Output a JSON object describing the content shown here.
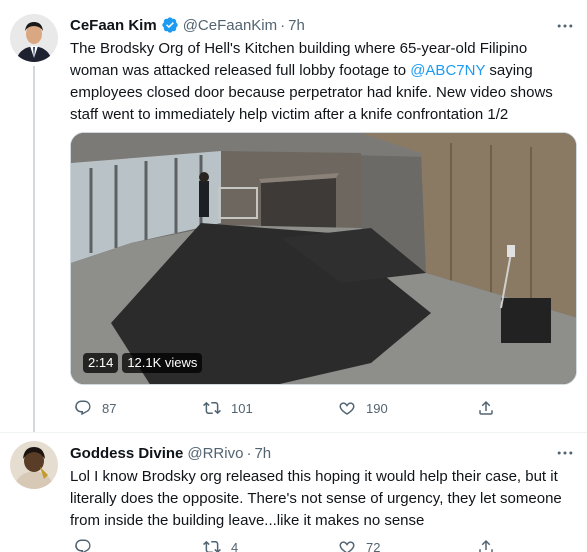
{
  "tweets": [
    {
      "author": {
        "name": "CeFaan Kim",
        "handle": "@CeFaanKim",
        "time": "7h",
        "verified": true
      },
      "text_before_mention": "The Brodsky Org of Hell's Kitchen building where 65-year-old Filipino woman was attacked released full lobby footage to ",
      "mention": "@ABC7NY",
      "text_after_mention": " saying employees closed door because perpetrator had knife. New video shows staff went to immediately help victim after a knife confrontation 1/2",
      "media": {
        "duration": "2:14",
        "views": "12.1K views"
      },
      "actions": {
        "replies": "87",
        "retweets": "101",
        "likes": "190"
      }
    },
    {
      "author": {
        "name": "Goddess Divine",
        "handle": "@RRivo",
        "time": "7h"
      },
      "text": "Lol I know Brodsky org released this hoping it would help their case, but it literally does the opposite. There's not sense of urgency, they let someone from inside the building leave...like it makes no sense",
      "actions": {
        "replies": "",
        "retweets": "4",
        "likes": "72"
      }
    }
  ],
  "colors": {
    "accent": "#1d9bf0",
    "secondary_text": "#536471",
    "divider": "#eff3f4"
  }
}
